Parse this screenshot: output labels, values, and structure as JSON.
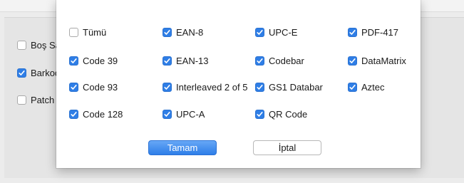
{
  "background": {
    "items": [
      {
        "label": "Boş Sa",
        "checked": false
      },
      {
        "label": "Barkod",
        "checked": true
      },
      {
        "label": "Patch",
        "checked": false
      }
    ]
  },
  "dialog": {
    "options": [
      {
        "label": "Tümü",
        "checked": false
      },
      {
        "label": "EAN-8",
        "checked": true
      },
      {
        "label": "UPC-E",
        "checked": true
      },
      {
        "label": "PDF-417",
        "checked": true
      },
      {
        "label": "Code 39",
        "checked": true
      },
      {
        "label": "EAN-13",
        "checked": true
      },
      {
        "label": "Codebar",
        "checked": true
      },
      {
        "label": "DataMatrix",
        "checked": true
      },
      {
        "label": "Code 93",
        "checked": true
      },
      {
        "label": "Interleaved 2 of 5",
        "checked": true
      },
      {
        "label": "GS1 Databar",
        "checked": true
      },
      {
        "label": "Aztec",
        "checked": true
      },
      {
        "label": "Code 128",
        "checked": true
      },
      {
        "label": "UPC-A",
        "checked": true
      },
      {
        "label": "QR Code",
        "checked": true
      }
    ],
    "ok_label": "Tamam",
    "cancel_label": "İptal"
  },
  "colors": {
    "accent": "#2f7ee6",
    "dialog_bg": "#ffffff",
    "window_bg": "#ececec"
  }
}
